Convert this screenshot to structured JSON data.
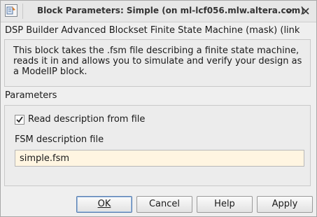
{
  "window": {
    "title": "Block Parameters: Simple (on ml-lcf056.mlw.altera.com)"
  },
  "titlebar_icons": [
    "app-icon",
    "minimize-icon",
    "close-icon"
  ],
  "header": {
    "text": "DSP Builder Advanced Blockset Finite State Machine (mask) (link"
  },
  "description": {
    "text": "This block takes the .fsm file describing a finite state machine, reads it in and allows you to simulate and verify your design as a ModelIP block."
  },
  "parameters": {
    "section_label": "Parameters",
    "read_from_file": {
      "label": "Read description from file",
      "checked": true
    },
    "fsm_file": {
      "label": "FSM description file",
      "value": "simple.fsm"
    }
  },
  "buttons": {
    "ok": "OK",
    "cancel": "Cancel",
    "help": "Help",
    "apply": "Apply"
  },
  "colors": {
    "dialog_bg": "#efefef",
    "input_bg": "#fff5e1",
    "default_button_border": "#5a7fb0"
  }
}
